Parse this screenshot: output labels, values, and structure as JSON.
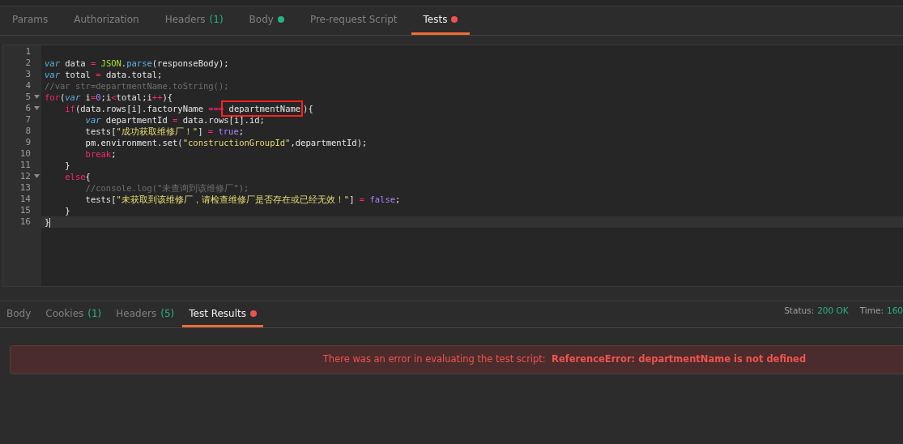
{
  "request_tabs": [
    {
      "label": "Params",
      "selected": false
    },
    {
      "label": "Authorization",
      "selected": false
    },
    {
      "label": "Headers",
      "count": "(1)",
      "selected": false
    },
    {
      "label": "Body",
      "color": "#26b47f",
      "selected": false
    },
    {
      "label": "Pre-request Script",
      "selected": false
    },
    {
      "label": "Tests",
      "color": "#ef5350",
      "selected": true
    }
  ],
  "editor": {
    "lines": [
      {
        "number": "1"
      },
      {
        "number": "2",
        "tokens": [
          {
            "t": "var",
            "kind": "storage"
          },
          {
            "t": " data ",
            "kind": "plain"
          },
          {
            "t": "=",
            "kind": "operator"
          },
          {
            "t": " JSON",
            "kind": "builtin"
          },
          {
            "t": ".",
            "kind": "plain"
          },
          {
            "t": "parse",
            "kind": "function"
          },
          {
            "t": "(responseBody);",
            "kind": "plain"
          }
        ]
      },
      {
        "number": "3",
        "tokens": [
          {
            "t": "var",
            "kind": "storage"
          },
          {
            "t": " total ",
            "kind": "plain"
          },
          {
            "t": "=",
            "kind": "operator"
          },
          {
            "t": " data.total;",
            "kind": "plain"
          }
        ]
      },
      {
        "number": "4",
        "tokens": [
          {
            "t": "//var str=departmentName.toString();",
            "kind": "comment"
          }
        ]
      },
      {
        "number": "5",
        "foldable": true,
        "tokens": [
          {
            "t": "for",
            "kind": "keyword"
          },
          {
            "t": "(",
            "kind": "plain"
          },
          {
            "t": "var",
            "kind": "storage"
          },
          {
            "t": " i",
            "kind": "plain"
          },
          {
            "t": "=",
            "kind": "operator"
          },
          {
            "t": "0",
            "kind": "constant"
          },
          {
            "t": ";i",
            "kind": "plain"
          },
          {
            "t": "<",
            "kind": "operator"
          },
          {
            "t": "total;i",
            "kind": "plain"
          },
          {
            "t": "++",
            "kind": "operator"
          },
          {
            "t": "){",
            "kind": "plain"
          }
        ]
      },
      {
        "number": "6",
        "foldable": true,
        "tokens": [
          {
            "t": "    if",
            "kind": "keyword"
          },
          {
            "t": "(data.rows[i].factoryName ",
            "kind": "plain"
          },
          {
            "t": "===",
            "kind": "operator"
          },
          {
            "t": " departmentName",
            "kind": "plain",
            "boxed": true
          },
          {
            "t": "){",
            "kind": "plain"
          }
        ]
      },
      {
        "number": "7",
        "tokens": [
          {
            "t": "        var",
            "kind": "storage"
          },
          {
            "t": " departmentId ",
            "kind": "plain"
          },
          {
            "t": "=",
            "kind": "operator"
          },
          {
            "t": " data.rows[i].id;",
            "kind": "plain"
          }
        ]
      },
      {
        "number": "8",
        "tokens": [
          {
            "t": "        tests[",
            "kind": "plain"
          },
          {
            "t": "\"成功获取维修厂！\"",
            "kind": "string"
          },
          {
            "t": "] ",
            "kind": "plain"
          },
          {
            "t": "=",
            "kind": "operator"
          },
          {
            "t": " true",
            "kind": "constant"
          },
          {
            "t": ";",
            "kind": "plain"
          }
        ]
      },
      {
        "number": "9",
        "tokens": [
          {
            "t": "        pm.environment.set(",
            "kind": "plain"
          },
          {
            "t": "\"constructionGroupId\"",
            "kind": "string"
          },
          {
            "t": ",departmentId);",
            "kind": "plain"
          }
        ]
      },
      {
        "number": "10",
        "tokens": [
          {
            "t": "        break",
            "kind": "keyword"
          },
          {
            "t": ";",
            "kind": "plain"
          }
        ]
      },
      {
        "number": "11",
        "tokens": [
          {
            "t": "    }",
            "kind": "plain"
          }
        ]
      },
      {
        "number": "12",
        "foldable": true,
        "tokens": [
          {
            "t": "    else",
            "kind": "keyword"
          },
          {
            "t": "{",
            "kind": "plain"
          }
        ]
      },
      {
        "number": "13",
        "tokens": [
          {
            "t": "        //console.log(\"未查询到该维修厂\");",
            "kind": "comment"
          }
        ]
      },
      {
        "number": "14",
        "tokens": [
          {
            "t": "        tests[",
            "kind": "plain"
          },
          {
            "t": "\"未获取到该维修厂，请检查维修厂是否存在或已经无效！\"",
            "kind": "string"
          },
          {
            "t": "] ",
            "kind": "plain"
          },
          {
            "t": "=",
            "kind": "operator"
          },
          {
            "t": " false",
            "kind": "constant"
          },
          {
            "t": ";",
            "kind": "plain"
          }
        ]
      },
      {
        "number": "15",
        "tokens": [
          {
            "t": "    }",
            "kind": "plain"
          }
        ]
      },
      {
        "number": "16",
        "active": true,
        "tokens": [
          {
            "t": "}",
            "kind": "plain"
          }
        ]
      }
    ]
  },
  "response_tabs": [
    {
      "label": "Body",
      "selected": false
    },
    {
      "label": "Cookies",
      "count": "(1)",
      "selected": false
    },
    {
      "label": "Headers",
      "count": "(5)",
      "selected": false
    },
    {
      "label": "Test Results",
      "color": "#ef5350",
      "selected": true
    }
  ],
  "status": [
    {
      "label": "Status:",
      "value": "200 OK"
    },
    {
      "label": "Time:",
      "value": "160"
    }
  ],
  "error": {
    "message": "There was an error in evaluating the test script:",
    "detail": "ReferenceError: departmentName is not defined"
  }
}
